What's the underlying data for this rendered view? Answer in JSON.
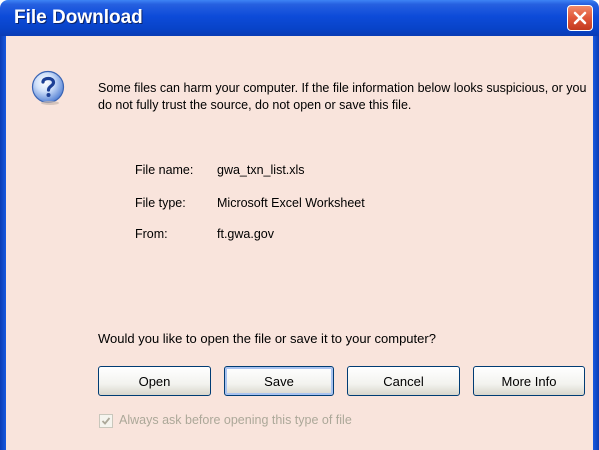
{
  "window": {
    "title": "File Download"
  },
  "icons": {
    "close": "close-icon",
    "question": "question-icon",
    "check": "checkmark-icon"
  },
  "message": {
    "warning": "Some files can harm your computer. If the file information below looks suspicious, or you do not fully trust the source, do not open or save this file.",
    "question": "Would you like to open the file or save it to your computer?"
  },
  "file_info": {
    "name_label": "File name:",
    "name_value": "gwa_txn_list.xls",
    "type_label": "File type:",
    "type_value": "Microsoft Excel Worksheet",
    "from_label": "From:",
    "from_value": "ft.gwa.gov"
  },
  "buttons": {
    "open": "Open",
    "save": "Save",
    "cancel": "Cancel",
    "more_info": "More Info"
  },
  "checkbox": {
    "label": "Always ask before opening this type of file",
    "checked": true,
    "disabled": true
  },
  "colors": {
    "titlebar": "#0843c8",
    "client_bg": "#f9e4dc",
    "close_button": "#e0573a",
    "button_border": "#003c74",
    "disabled_text": "#aca899"
  }
}
